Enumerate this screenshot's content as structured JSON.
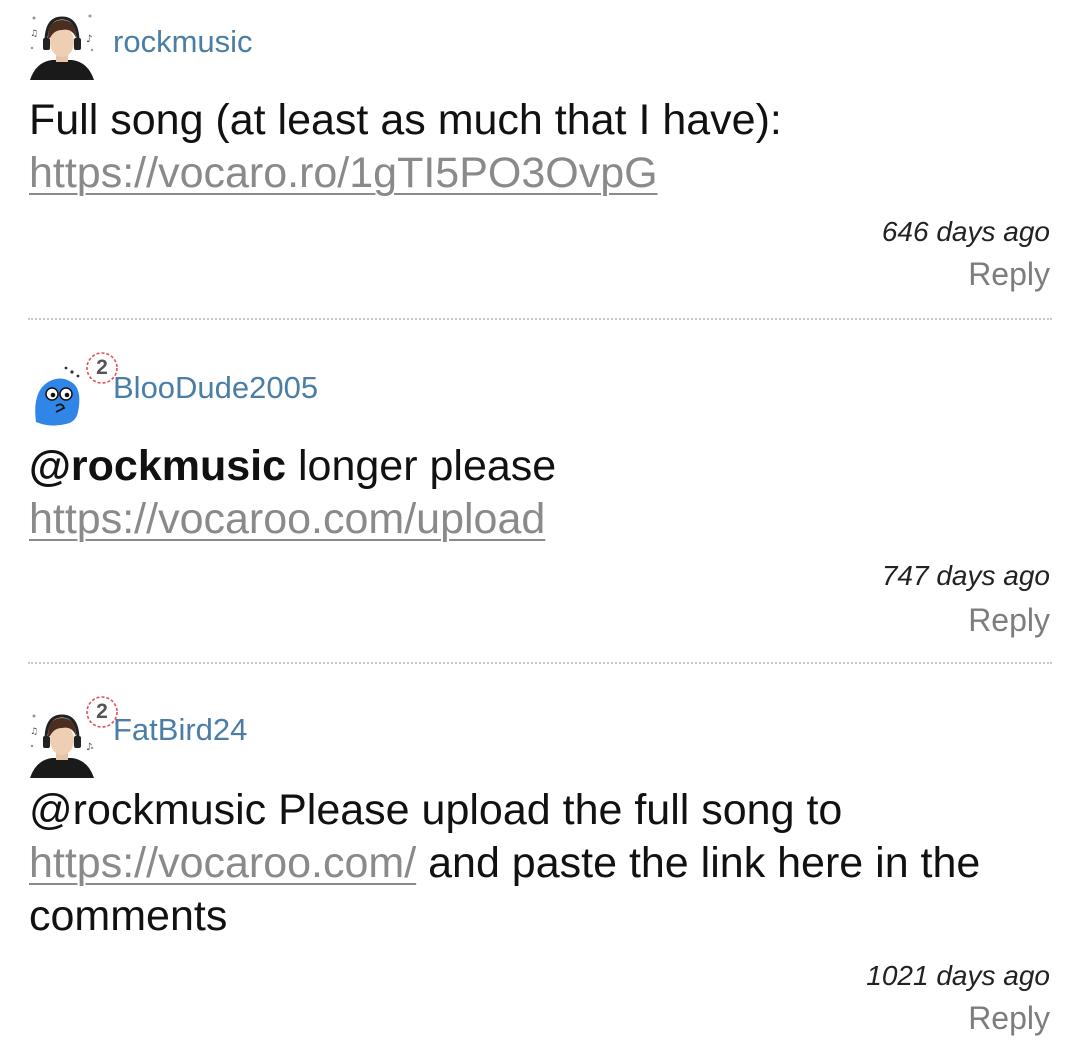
{
  "comments": [
    {
      "username": "rockmusic",
      "text_before": "Full song (at least as much that I have): ",
      "link": "https://vocaro.ro/1gTI5PO3OvpG",
      "time": "646 days ago",
      "reply_label": "Reply",
      "avatar_icon": "headphones-user-avatar"
    },
    {
      "username": "BlooDude2005",
      "badge": "2",
      "mention": "@rockmusic",
      "text_after_mention": " longer please",
      "link": "https://vocaroo.com/upload",
      "time": "747 days ago",
      "reply_label": "Reply",
      "avatar_icon": "blue-blob-avatar"
    },
    {
      "username": "FatBird24",
      "badge": "2",
      "text_before": "@rockmusic Please upload the full song to ",
      "link": "https://vocaroo.com/",
      "text_after": " and paste the link here in the comments",
      "time": "1021 days ago",
      "reply_label": "Reply",
      "avatar_icon": "headphones-user-avatar"
    }
  ],
  "colors": {
    "username": "#4b7ea6",
    "link": "#8a8a8a",
    "reply": "#7d7d7d",
    "badge_ring": "#e05050",
    "blob_blue": "#2f86e6"
  }
}
